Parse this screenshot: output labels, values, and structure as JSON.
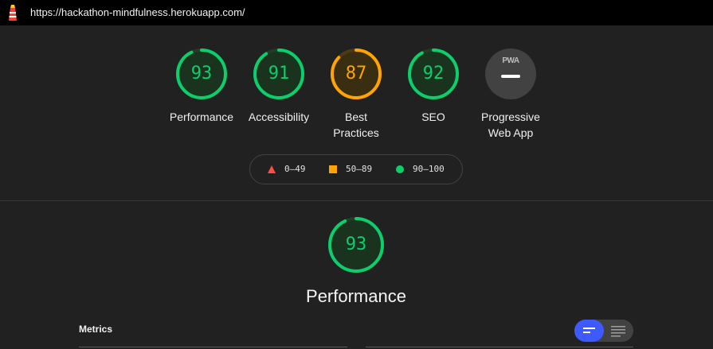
{
  "browser": {
    "url": "https://hackathon-mindfulness.herokuapp.com/"
  },
  "colors": {
    "pass": "#0cce6b",
    "average": "#ffa400",
    "fail": "#ff4e42",
    "accent": "#3d5afe"
  },
  "gauges": [
    {
      "value": "93",
      "label": "Performance",
      "score": 0.93,
      "status": "pass"
    },
    {
      "value": "91",
      "label": "Accessibility",
      "score": 0.91,
      "status": "pass"
    },
    {
      "value": "87",
      "label_line1": "Best",
      "label_line2": "Practices",
      "score": 0.87,
      "status": "average"
    },
    {
      "value": "92",
      "label": "SEO",
      "score": 0.92,
      "status": "pass"
    },
    {
      "badge": "PWA",
      "label_line1": "Progressive",
      "label_line2": "Web App",
      "icon": "pwa-dash-icon"
    }
  ],
  "legend": [
    {
      "range": "0–49",
      "icon": "fail-triangle-icon"
    },
    {
      "range": "50–89",
      "icon": "average-square-icon"
    },
    {
      "range": "90–100",
      "icon": "pass-circle-icon"
    }
  ],
  "category": {
    "value": "93",
    "title": "Performance",
    "score": 0.93
  },
  "metrics": {
    "label": "Metrics",
    "view_toggle": {
      "selected": "compact-view",
      "options": [
        "compact-view-icon",
        "expanded-view-icon"
      ]
    }
  }
}
